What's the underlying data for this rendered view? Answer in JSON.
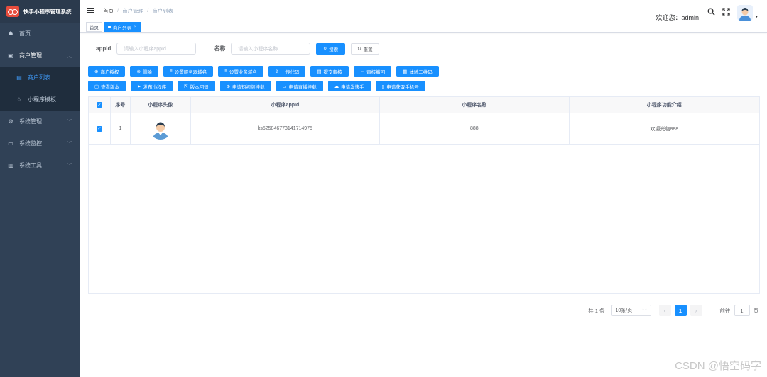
{
  "app": {
    "title": "快手小程序管理系统"
  },
  "sidebar": {
    "items": [
      {
        "label": "首页",
        "icon": "dashboard-icon"
      },
      {
        "label": "商户管理",
        "icon": "shop-icon"
      },
      {
        "label": "商户列表",
        "icon": "list-icon"
      },
      {
        "label": "小程序模板",
        "icon": "star-icon"
      },
      {
        "label": "系统管理",
        "icon": "gear-icon"
      },
      {
        "label": "系统监控",
        "icon": "monitor-icon"
      },
      {
        "label": "系统工具",
        "icon": "toolbox-icon"
      }
    ]
  },
  "navbar": {
    "breadcrumb": [
      "首页",
      "商户管理",
      "商户列表"
    ],
    "welcome": "欢迎您：admin"
  },
  "tags": {
    "home": "首页",
    "active": "商户列表"
  },
  "search": {
    "appid_label": "appId",
    "appid_placeholder": "请输入小程序appId",
    "name_label": "名称",
    "name_placeholder": "请输入小程序名称",
    "search_btn": "搜索",
    "reset_btn": "重置"
  },
  "toolbar": {
    "row1": [
      "商户授权",
      "删除",
      "设置服务器域名",
      "设置业务域名",
      "上传代码",
      "提交审核",
      "审核撤回",
      "体验二维码"
    ],
    "row2": [
      "查看版本",
      "发布小程序",
      "版本回退",
      "申请短视频挂载",
      "申请直播挂载",
      "申请发快手",
      "申请获取手机号"
    ]
  },
  "table": {
    "headers": [
      "序号",
      "小程序头像",
      "小程序appId",
      "小程序名称",
      "小程序功能介绍"
    ],
    "rows": [
      {
        "index": "1",
        "appid": "ks525846773141714975",
        "name": "888",
        "desc": "欢迎光临888"
      }
    ]
  },
  "pagination": {
    "total": "共 1 条",
    "page_size": "10条/页",
    "current_page": "1",
    "goto_label": "前往",
    "goto_value": "1",
    "page_suffix": "页"
  },
  "watermark": "CSDN @悟空码字",
  "colors": {
    "sidebar_bg": "#304156",
    "primary": "#1890ff",
    "active_menu": "#409eff"
  }
}
